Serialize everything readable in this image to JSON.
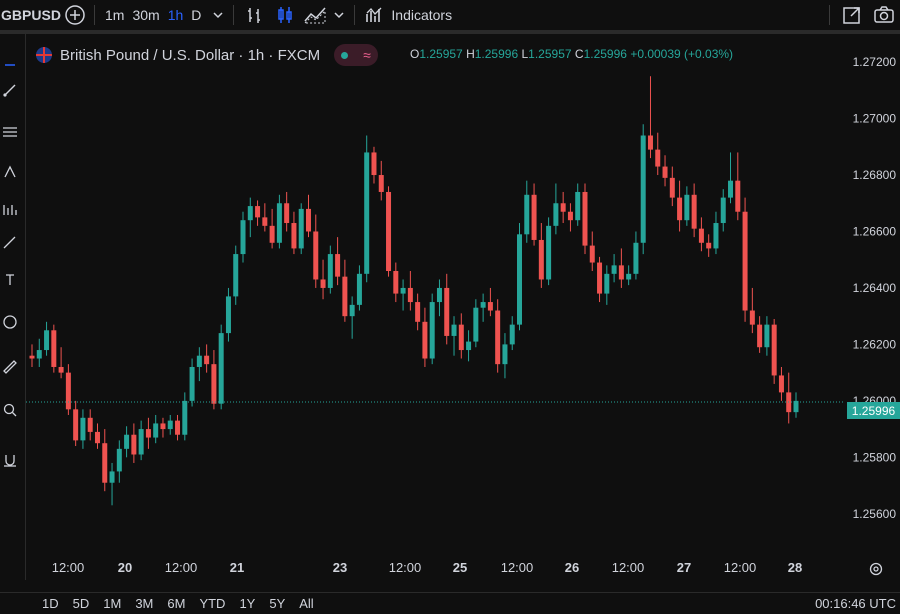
{
  "toolbar": {
    "symbol": "GBPUSD",
    "intervals": [
      "1m",
      "30m",
      "1h",
      "D"
    ],
    "active_interval": "1h",
    "indicators_label": "Indicators"
  },
  "legend": {
    "instrument": "British Pound / U.S. Dollar · 1h · FXCM",
    "open_label": "O",
    "open": "1.25957",
    "high_label": "H",
    "high": "1.25996",
    "low_label": "L",
    "low": "1.25957",
    "close_label": "C",
    "close": "1.25996",
    "change": "+0.00039 (+0.03%)"
  },
  "price_label": "1.25996",
  "bottom": {
    "ranges": [
      "1D",
      "5D",
      "1M",
      "3M",
      "6M",
      "YTD",
      "1Y",
      "5Y",
      "All"
    ],
    "clock": "00:16:46 UTC"
  },
  "colors": {
    "up": "#26a69a",
    "down": "#ef5350",
    "background": "#0f0f0f",
    "accent": "#2962ff"
  },
  "chart_data": {
    "type": "candlestick",
    "title": "British Pound / U.S. Dollar · 1h · FXCM",
    "ylim": [
      1.255,
      1.2725
    ],
    "y_ticks": [
      "1.27200",
      "1.27000",
      "1.26800",
      "1.26600",
      "1.26400",
      "1.26200",
      "1.26000",
      "1.25800",
      "1.25600"
    ],
    "x_ticks": [
      "12:00",
      "20",
      "12:00",
      "21",
      "23",
      "12:00",
      "25",
      "12:00",
      "26",
      "12:00",
      "27",
      "12:00",
      "28"
    ],
    "last_price": 1.25996,
    "grid": false,
    "candles": [
      [
        1.2616,
        1.262,
        1.2612,
        1.2615
      ],
      [
        1.2615,
        1.2622,
        1.2612,
        1.2618
      ],
      [
        1.2618,
        1.2628,
        1.2616,
        1.2625
      ],
      [
        1.2625,
        1.2627,
        1.261,
        1.2612
      ],
      [
        1.2612,
        1.2619,
        1.2608,
        1.261
      ],
      [
        1.261,
        1.2613,
        1.2595,
        1.2597
      ],
      [
        1.2597,
        1.26,
        1.2584,
        1.2586
      ],
      [
        1.2586,
        1.2597,
        1.2583,
        1.2594
      ],
      [
        1.2594,
        1.2597,
        1.2586,
        1.2589
      ],
      [
        1.2589,
        1.2592,
        1.2583,
        1.2585
      ],
      [
        1.2585,
        1.259,
        1.2568,
        1.2571
      ],
      [
        1.2571,
        1.2578,
        1.2563,
        1.2575
      ],
      [
        1.2575,
        1.2586,
        1.2571,
        1.2583
      ],
      [
        1.2583,
        1.2591,
        1.258,
        1.2588
      ],
      [
        1.2588,
        1.2592,
        1.2578,
        1.2581
      ],
      [
        1.2581,
        1.2593,
        1.2579,
        1.259
      ],
      [
        1.259,
        1.2594,
        1.2583,
        1.2587
      ],
      [
        1.2587,
        1.2595,
        1.2585,
        1.2592
      ],
      [
        1.2592,
        1.2594,
        1.2587,
        1.259
      ],
      [
        1.259,
        1.2595,
        1.2588,
        1.2593
      ],
      [
        1.2593,
        1.2595,
        1.2586,
        1.2588
      ],
      [
        1.2588,
        1.2603,
        1.2586,
        1.26
      ],
      [
        1.26,
        1.2615,
        1.2598,
        1.2612
      ],
      [
        1.2612,
        1.2619,
        1.2607,
        1.2616
      ],
      [
        1.2616,
        1.262,
        1.261,
        1.2613
      ],
      [
        1.2613,
        1.2618,
        1.2597,
        1.2599
      ],
      [
        1.2599,
        1.2627,
        1.2597,
        1.2624
      ],
      [
        1.2624,
        1.264,
        1.2621,
        1.2637
      ],
      [
        1.2637,
        1.2655,
        1.2634,
        1.2652
      ],
      [
        1.2652,
        1.2667,
        1.2649,
        1.2664
      ],
      [
        1.2664,
        1.2672,
        1.2658,
        1.2669
      ],
      [
        1.2669,
        1.2671,
        1.2662,
        1.2665
      ],
      [
        1.2665,
        1.267,
        1.266,
        1.2662
      ],
      [
        1.2662,
        1.2668,
        1.2654,
        1.2656
      ],
      [
        1.2656,
        1.2673,
        1.2654,
        1.267
      ],
      [
        1.267,
        1.2674,
        1.266,
        1.2663
      ],
      [
        1.2663,
        1.2667,
        1.2652,
        1.2654
      ],
      [
        1.2654,
        1.267,
        1.2652,
        1.2668
      ],
      [
        1.2668,
        1.2673,
        1.2658,
        1.266
      ],
      [
        1.266,
        1.2666,
        1.264,
        1.2643
      ],
      [
        1.2643,
        1.265,
        1.2636,
        1.264
      ],
      [
        1.264,
        1.2655,
        1.2638,
        1.2652
      ],
      [
        1.2652,
        1.2658,
        1.2641,
        1.2644
      ],
      [
        1.2644,
        1.265,
        1.2628,
        1.263
      ],
      [
        1.263,
        1.2637,
        1.2622,
        1.2634
      ],
      [
        1.2634,
        1.2648,
        1.2632,
        1.2645
      ],
      [
        1.2645,
        1.2694,
        1.2642,
        1.2688
      ],
      [
        1.2688,
        1.269,
        1.2677,
        1.268
      ],
      [
        1.268,
        1.2685,
        1.2671,
        1.2674
      ],
      [
        1.2674,
        1.2676,
        1.2644,
        1.2646
      ],
      [
        1.2646,
        1.2649,
        1.2635,
        1.2638
      ],
      [
        1.2638,
        1.2643,
        1.2632,
        1.264
      ],
      [
        1.264,
        1.2646,
        1.2632,
        1.2635
      ],
      [
        1.2635,
        1.2638,
        1.2625,
        1.2628
      ],
      [
        1.2628,
        1.2633,
        1.2612,
        1.2615
      ],
      [
        1.2615,
        1.2638,
        1.2613,
        1.2635
      ],
      [
        1.2635,
        1.2643,
        1.263,
        1.264
      ],
      [
        1.264,
        1.2645,
        1.262,
        1.2623
      ],
      [
        1.2623,
        1.263,
        1.2616,
        1.2627
      ],
      [
        1.2627,
        1.2631,
        1.2615,
        1.2618
      ],
      [
        1.2618,
        1.2625,
        1.2614,
        1.2621
      ],
      [
        1.2621,
        1.2636,
        1.2619,
        1.2633
      ],
      [
        1.2633,
        1.2638,
        1.2628,
        1.2635
      ],
      [
        1.2635,
        1.264,
        1.263,
        1.2632
      ],
      [
        1.2632,
        1.2636,
        1.261,
        1.2613
      ],
      [
        1.2613,
        1.2624,
        1.2608,
        1.262
      ],
      [
        1.262,
        1.263,
        1.2618,
        1.2627
      ],
      [
        1.2627,
        1.2663,
        1.2625,
        1.2659
      ],
      [
        1.2659,
        1.2678,
        1.2656,
        1.2673
      ],
      [
        1.2673,
        1.2677,
        1.2655,
        1.2657
      ],
      [
        1.2657,
        1.2663,
        1.264,
        1.2643
      ],
      [
        1.2643,
        1.2665,
        1.2641,
        1.2662
      ],
      [
        1.2662,
        1.2677,
        1.2659,
        1.267
      ],
      [
        1.267,
        1.2674,
        1.2663,
        1.2667
      ],
      [
        1.2667,
        1.267,
        1.266,
        1.2664
      ],
      [
        1.2664,
        1.2677,
        1.2662,
        1.2674
      ],
      [
        1.2674,
        1.2677,
        1.2652,
        1.2655
      ],
      [
        1.2655,
        1.266,
        1.2646,
        1.2649
      ],
      [
        1.2649,
        1.2651,
        1.2635,
        1.2638
      ],
      [
        1.2638,
        1.2648,
        1.2634,
        1.2645
      ],
      [
        1.2645,
        1.2652,
        1.2642,
        1.2648
      ],
      [
        1.2648,
        1.2654,
        1.264,
        1.2643
      ],
      [
        1.2643,
        1.2648,
        1.2641,
        1.2645
      ],
      [
        1.2645,
        1.266,
        1.2643,
        1.2656
      ],
      [
        1.2656,
        1.2698,
        1.2652,
        1.2694
      ],
      [
        1.2694,
        1.2715,
        1.2686,
        1.2689
      ],
      [
        1.2689,
        1.2695,
        1.268,
        1.2683
      ],
      [
        1.2683,
        1.2687,
        1.2676,
        1.2679
      ],
      [
        1.2679,
        1.2683,
        1.2669,
        1.2672
      ],
      [
        1.2672,
        1.2678,
        1.266,
        1.2664
      ],
      [
        1.2664,
        1.2676,
        1.2662,
        1.2673
      ],
      [
        1.2673,
        1.2677,
        1.2658,
        1.2661
      ],
      [
        1.2661,
        1.2665,
        1.2653,
        1.2656
      ],
      [
        1.2656,
        1.2659,
        1.2651,
        1.2654
      ],
      [
        1.2654,
        1.2667,
        1.2652,
        1.2663
      ],
      [
        1.2663,
        1.2675,
        1.266,
        1.2672
      ],
      [
        1.2672,
        1.2688,
        1.267,
        1.2678
      ],
      [
        1.2678,
        1.2688,
        1.2664,
        1.2667
      ],
      [
        1.2667,
        1.2672,
        1.2628,
        1.2632
      ],
      [
        1.2632,
        1.264,
        1.2624,
        1.2627
      ],
      [
        1.2627,
        1.263,
        1.2617,
        1.2619
      ],
      [
        1.2619,
        1.263,
        1.2616,
        1.2627
      ],
      [
        1.2627,
        1.2629,
        1.2606,
        1.2609
      ],
      [
        1.2609,
        1.2612,
        1.26,
        1.2603
      ],
      [
        1.2603,
        1.261,
        1.2592,
        1.2596
      ],
      [
        1.2596,
        1.2603,
        1.2594,
        1.26
      ]
    ]
  }
}
